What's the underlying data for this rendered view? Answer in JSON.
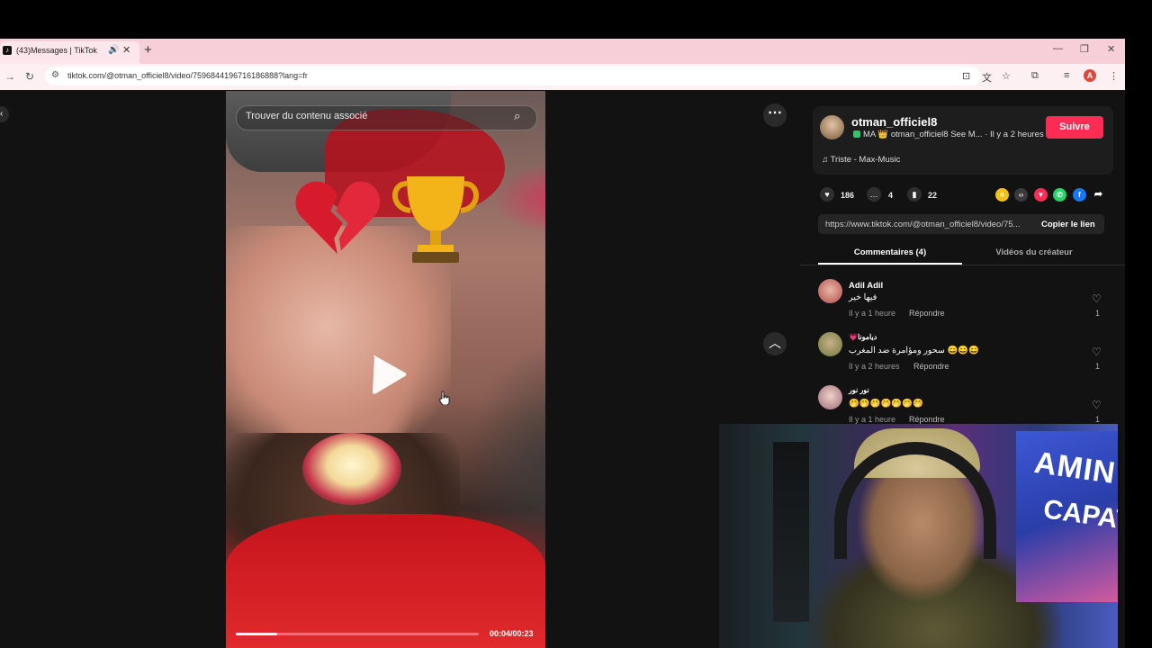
{
  "browser": {
    "tab_title": "(43)Messages | TikTok",
    "new_tab_symbol": "+",
    "url": "tiktok.com/@otman_officiel8/video/7596844196716186888?lang=fr",
    "profile_initial": "A"
  },
  "video": {
    "search_placeholder": "Trouver du contenu associé",
    "time": "00:04/00:23",
    "progress": 0.17,
    "heart_emoji": "💔",
    "trophy_emoji": "🏆"
  },
  "author": {
    "name": "otman_officiel8",
    "subtitle": "MA 👑 otman_officiel8 See M... · Il y a 2 heures",
    "follow_label": "Suivre",
    "music": "Triste - Max-Music"
  },
  "stats": {
    "likes": "186",
    "comments": "4",
    "saves": "22"
  },
  "link": {
    "url": "https://www.tiktok.com/@otman_officiel8/video/75...",
    "copy_label": "Copier le lien"
  },
  "tabs": {
    "comments": "Commentaires (4)",
    "creator_videos": "Vidéos du créateur"
  },
  "comments": [
    {
      "name": "Adil Adil",
      "text": "فيها خير",
      "time": "Il y a 1 heure",
      "reply": "Répondre",
      "likes": "1"
    },
    {
      "name": "💗ديامونا",
      "text": "سحور ومؤامرة ضد المغرب 😄😄😄",
      "time": "Il y a 2 heures",
      "reply": "Répondre",
      "likes": "1"
    },
    {
      "name": "نور نور",
      "text": "🤭🤭🤭🤭🤭🤭🤭",
      "time": "Il y a 1 heure",
      "reply": "Répondre",
      "likes": "1"
    }
  ],
  "webcam": {
    "wall_text_1": "AMIN",
    "wall_text_2": "CAPAT"
  },
  "colors": {
    "accent": "#fe2c55",
    "tabbar": "#f7cfd8"
  }
}
